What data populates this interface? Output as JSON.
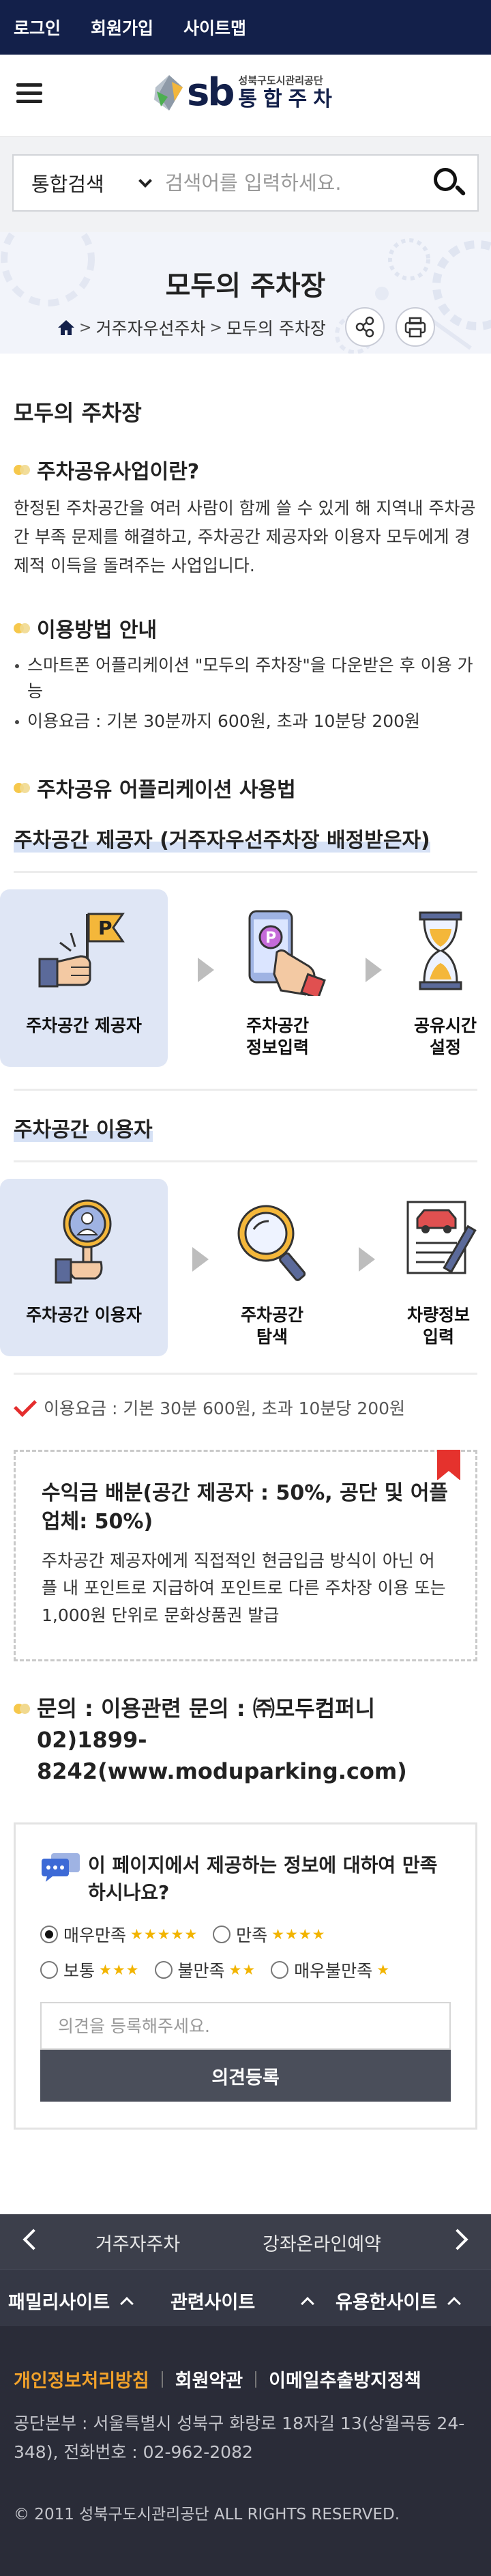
{
  "topbar": {
    "links": [
      "로그인",
      "회원가입",
      "사이트맵"
    ]
  },
  "header": {
    "logo_small": "성북구도시관리공단",
    "logo_big": "통합주차",
    "logo_sb": "sb"
  },
  "search": {
    "category": "통합검색",
    "placeholder": "검색어를 입력하세요."
  },
  "title_band": {
    "title": "모두의 주차장",
    "crumb_1": "거주자우선주차",
    "crumb_sep": ">",
    "crumb_2": "모두의 주차장"
  },
  "content": {
    "heading": "모두의 주차장",
    "s1_title": "주차공유사업이란?",
    "s1_text": "한정된 주차공간을 여러 사람이 함께 쓸 수 있게 해 지역내 주차공간 부족 문제를 해결하고, 주차공간 제공자와 이용자 모두에게 경제적 이득을 돌려주는 사업입니다.",
    "s2_title": "이용방법 안내",
    "s2_bullets": [
      "스마트폰 어플리케이션 \"모두의 주차장\"을 다운받은 후 이용 가능",
      "이용요금 : 기본 30분까지 600원, 초과 10분당 200원"
    ],
    "s3_title": "주차공유 어플리케이션 사용법",
    "provider_title": "주차공간 제공자 (거주자우선주차장 배정받은자)",
    "provider_steps": [
      "주차공간 제공자",
      "주차공간\n정보입력",
      "공유시간\n설정"
    ],
    "user_title": "주차공간 이용자",
    "user_steps": [
      "주차공간 이용자",
      "주차공간\n탐색",
      "차량정보\n입력"
    ],
    "fee_note": "이용요금 : 기본 30분 600원, 초과 10분당 200원",
    "box_title": "수익금 배분(공간 제공자 : 50%, 공단 및 어플 업체: 50%)",
    "box_text": "주차공간 제공자에게 직접적인 현금입금 방식이 아닌 어플 내 포인트로 지급하여 포인트로 다른 주차장 이용 또는 1,000원 단위로 문화상품권 발급",
    "contact": "문의 : 이용관련 문의 : ㈜모두컴퍼니 02)1899-8242(www.moduparking.com)"
  },
  "survey": {
    "question": "이 페이지에서 제공하는 정보에 대하여 만족하시나요?",
    "options": [
      {
        "label": "매우만족",
        "stars": "★★★★★",
        "selected": true
      },
      {
        "label": "만족",
        "stars": "★★★★",
        "selected": false
      },
      {
        "label": "보통",
        "stars": "★★★",
        "selected": false
      },
      {
        "label": "불만족",
        "stars": "★★",
        "selected": false
      },
      {
        "label": "매우불만족",
        "stars": "★",
        "selected": false
      }
    ],
    "placeholder": "의견을 등록해주세요.",
    "submit": "의견등록"
  },
  "footer": {
    "nav_1": "거주자주차",
    "nav_2": "강좌온라인예약",
    "site_1": "패밀리사이트",
    "site_2": "관련사이트",
    "site_3": "유용한사이트",
    "link_privacy": "개인정보처리방침",
    "link_terms": "회원약관",
    "link_email": "이메일추출방지정책",
    "address": "공단본부 : 서울특별시 성북구 화랑로 18자길 13(상월곡동 24-348), 전화번호 : 02-962-2082",
    "copyright": "© 2011 성북구도시관리공단 ALL RIGHTS RESERVED."
  },
  "colors": {
    "navy": "#13204a",
    "accent_red": "#e5322d",
    "footer_link": "#f0a12a",
    "star": "#f2b400"
  }
}
